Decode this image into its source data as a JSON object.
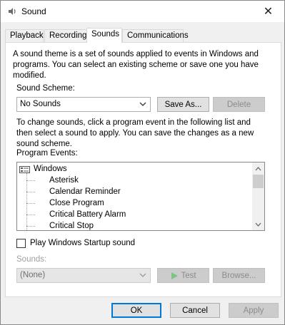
{
  "window": {
    "title": "Sound",
    "close_glyph": "✕"
  },
  "tabs": [
    {
      "label": "Playback",
      "active": false
    },
    {
      "label": "Recording",
      "active": false
    },
    {
      "label": "Sounds",
      "active": true
    },
    {
      "label": "Communications",
      "active": false
    }
  ],
  "sounds": {
    "description": "A sound theme is a set of sounds applied to events in Windows and programs.  You can select an existing scheme or save one you have modified.",
    "scheme_label": "Sound Scheme:",
    "scheme_value": "No Sounds",
    "save_as_label": "Save As...",
    "delete_label": "Delete",
    "instructions": "To change sounds, click a program event in the following list and then select a sound to apply.  You can save the changes as a new sound scheme.",
    "events_label": "Program Events:",
    "events": {
      "root": "Windows",
      "items": [
        "Asterisk",
        "Calendar Reminder",
        "Close Program",
        "Critical Battery Alarm",
        "Critical Stop"
      ]
    },
    "startup_checkbox_label": "Play Windows Startup sound",
    "startup_checked": false,
    "sounds_label": "Sounds:",
    "sounds_value": "(None)",
    "test_label": "Test",
    "browse_label": "Browse..."
  },
  "footer": {
    "ok_label": "OK",
    "cancel_label": "Cancel",
    "apply_label": "Apply"
  },
  "colors": {
    "focus_border": "#0078d7",
    "disabled_text": "#a0a0a0",
    "test_icon": "#4caf50"
  },
  "icons": {
    "title": "speaker-icon",
    "dropdown": "chevron-down-icon",
    "tree_root": "windows-folder-icon",
    "play": "play-icon"
  }
}
